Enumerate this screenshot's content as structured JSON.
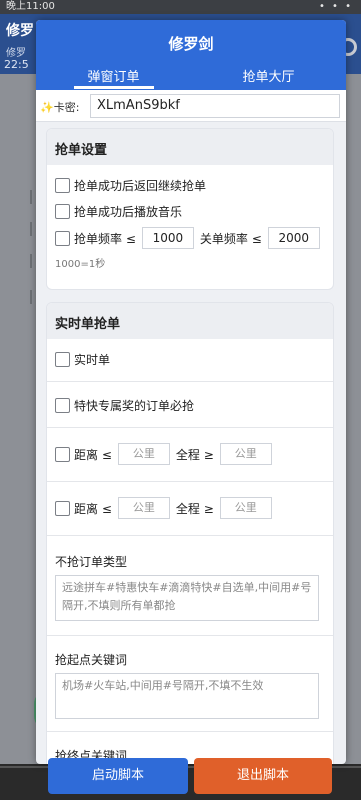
{
  "background": {
    "status_text": "晚上11:00",
    "app_title": "修罗",
    "app_sub": "修罗",
    "time": "22:5"
  },
  "dialog": {
    "title": "修罗剑",
    "tabs": [
      {
        "label": "弹窗订单"
      },
      {
        "label": "抢单大厅"
      }
    ],
    "key": {
      "label": "卡密:",
      "value": "XLmAnS9bkf"
    }
  },
  "settings": {
    "title": "抢单设置",
    "return_after_success": "抢单成功后返回继续抢单",
    "play_music_after_success": "抢单成功后播放音乐",
    "grab_freq_label": "抢单频率 ≤",
    "grab_freq_value": "1000",
    "close_freq_label": "关单频率 ≤",
    "close_freq_value": "2000",
    "freq_hint": "1000=1秒"
  },
  "realtime": {
    "title": "实时单抢单",
    "realtime_order": "实时单",
    "express_must_grab": "特快专属奖的订单必抢",
    "distance_rows": [
      {
        "distance_label": "距离 ≤",
        "distance_placeholder": "公里",
        "total_label": "全程 ≥",
        "total_placeholder": "公里"
      },
      {
        "distance_label": "距离 ≤",
        "distance_placeholder": "公里",
        "total_label": "全程 ≥",
        "total_placeholder": "公里"
      }
    ],
    "exclude_types_label": "不抢订单类型",
    "exclude_types_placeholder": "远途拼车#特惠快车#滴滴特快#自选单,中间用#号隔开,不填则所有单都抢",
    "start_keywords_label": "抢起点关键词",
    "start_keywords_placeholder": "机场#火车站,中间用#号隔开,不填不生效",
    "end_keywords_label": "抢终点关键词"
  },
  "buttons": {
    "start": "启动脚本",
    "exit": "退出脚本"
  }
}
